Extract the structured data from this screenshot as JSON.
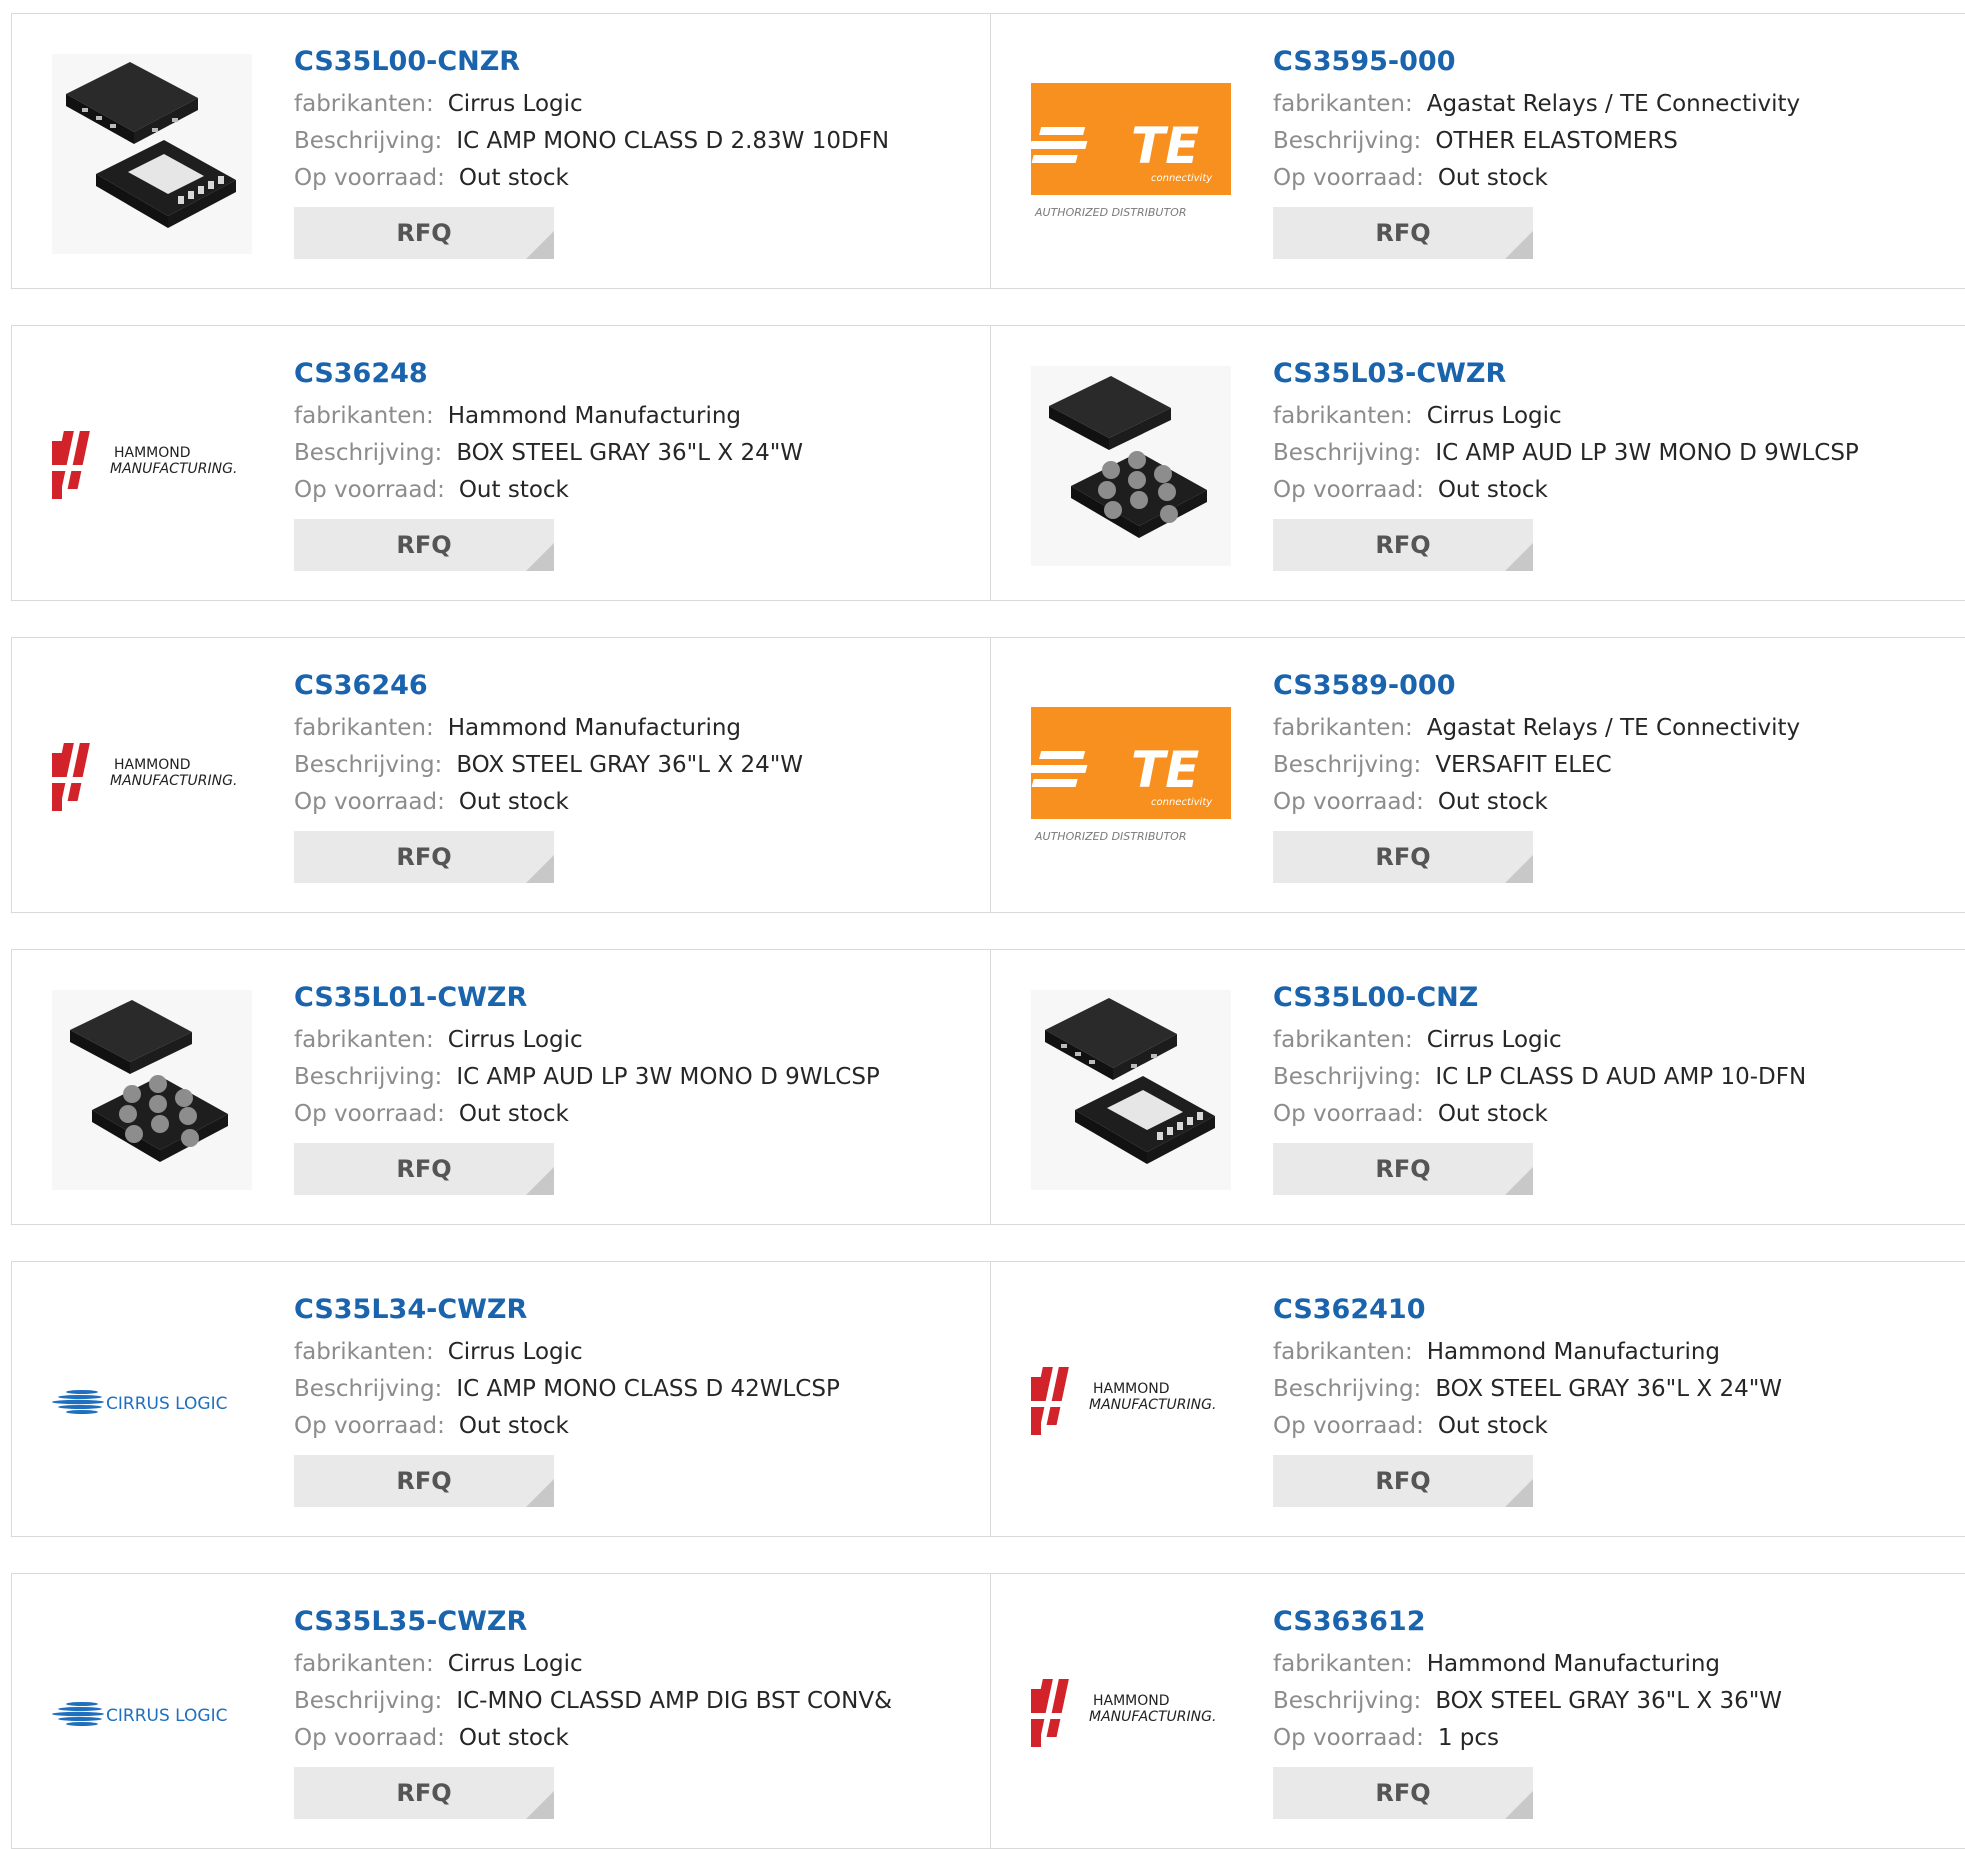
{
  "labels": {
    "manufacturer": "fabrikanten:",
    "description": "Beschrijving:",
    "stock": "Op voorraad:",
    "rfq": "RFQ"
  },
  "logos": {
    "te_text": "TE",
    "te_small": "connectivity",
    "te_caption": "AUTHORIZED DISTRIBUTOR",
    "hammond_line1": "HAMMOND",
    "hammond_line2": "MANUFACTURING.",
    "cirrus_text": "CIRRUS LOGIC"
  },
  "colors": {
    "link": "#1a63ad",
    "te_orange": "#f7901e",
    "hammond_red": "#d2232a",
    "cirrus_blue": "#1f6fbf",
    "rfq_bg": "#e9e9e9"
  },
  "products": [
    {
      "part": "CS35L00-CNZR",
      "manufacturer": "Cirrus Logic",
      "description": "IC AMP MONO CLASS D 2.83W 10DFN",
      "stock": "Out stock",
      "image": "dfn10-chip-image"
    },
    {
      "part": "CS3595-000",
      "manufacturer": "Agastat Relays / TE Connectivity",
      "description": "OTHER ELASTOMERS",
      "stock": "Out stock",
      "image": "te-connectivity-logo"
    },
    {
      "part": "CS36248",
      "manufacturer": "Hammond Manufacturing",
      "description": "BOX STEEL GRAY 36\"L X 24\"W",
      "stock": "Out stock",
      "image": "hammond-logo"
    },
    {
      "part": "CS35L03-CWZR",
      "manufacturer": "Cirrus Logic",
      "description": "IC AMP AUD LP 3W MONO D 9WLCSP",
      "stock": "Out stock",
      "image": "wlcsp9-chip-image"
    },
    {
      "part": "CS36246",
      "manufacturer": "Hammond Manufacturing",
      "description": "BOX STEEL GRAY 36\"L X 24\"W",
      "stock": "Out stock",
      "image": "hammond-logo"
    },
    {
      "part": "CS3589-000",
      "manufacturer": "Agastat Relays / TE Connectivity",
      "description": "VERSAFIT ELEC",
      "stock": "Out stock",
      "image": "te-connectivity-logo"
    },
    {
      "part": "CS35L01-CWZR",
      "manufacturer": "Cirrus Logic",
      "description": "IC AMP AUD LP 3W MONO D 9WLCSP",
      "stock": "Out stock",
      "image": "wlcsp9-chip-image"
    },
    {
      "part": "CS35L00-CNZ",
      "manufacturer": "Cirrus Logic",
      "description": "IC LP CLASS D AUD AMP 10-DFN",
      "stock": "Out stock",
      "image": "dfn10-chip-image"
    },
    {
      "part": "CS35L34-CWZR",
      "manufacturer": "Cirrus Logic",
      "description": "IC AMP MONO CLASS D 42WLCSP",
      "stock": "Out stock",
      "image": "cirrus-logic-logo"
    },
    {
      "part": "CS362410",
      "manufacturer": "Hammond Manufacturing",
      "description": "BOX STEEL GRAY 36\"L X 24\"W",
      "stock": "Out stock",
      "image": "hammond-logo"
    },
    {
      "part": "CS35L35-CWZR",
      "manufacturer": "Cirrus Logic",
      "description": "IC-MNO CLASSD AMP DIG BST CONV&",
      "stock": "Out stock",
      "image": "cirrus-logic-logo"
    },
    {
      "part": "CS363612",
      "manufacturer": "Hammond Manufacturing",
      "description": "BOX STEEL GRAY 36\"L X 36\"W",
      "stock": "1 pcs",
      "image": "hammond-logo"
    }
  ]
}
